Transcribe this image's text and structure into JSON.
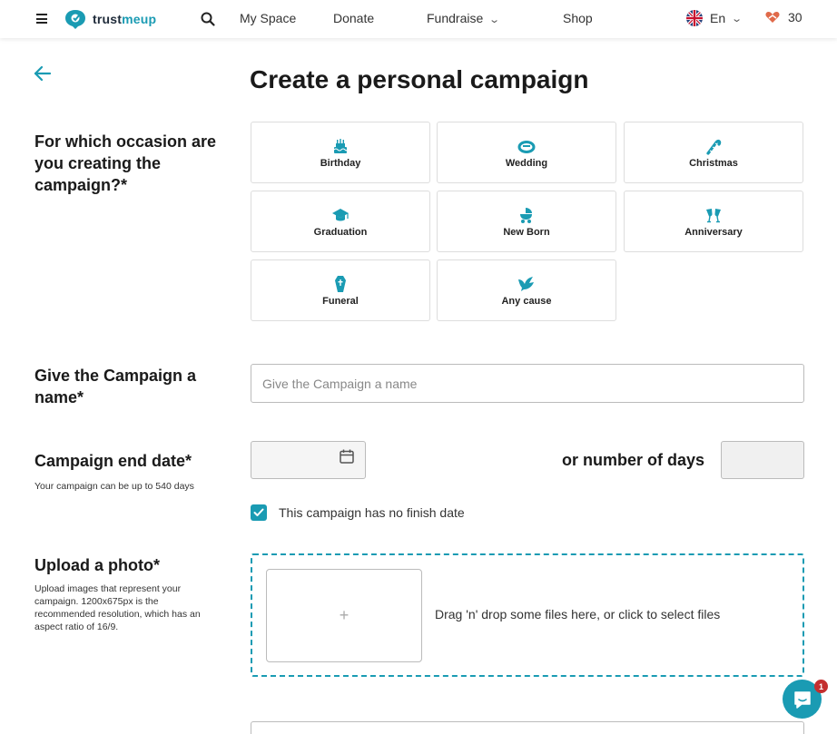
{
  "header": {
    "logo_prefix": "trust",
    "logo_suffix": "meup",
    "nav": [
      "My Space",
      "Donate",
      "Fundraise",
      "Shop"
    ],
    "language": "En",
    "points": "30"
  },
  "page": {
    "title": "Create a personal campaign"
  },
  "occasion": {
    "label": "For which occasion are you creating the campaign?*",
    "options": [
      {
        "label": "Birthday",
        "icon": "birthday-cake-icon"
      },
      {
        "label": "Wedding",
        "icon": "ring-icon"
      },
      {
        "label": "Christmas",
        "icon": "candy-cane-icon"
      },
      {
        "label": "Graduation",
        "icon": "graduation-cap-icon"
      },
      {
        "label": "New Born",
        "icon": "baby-carriage-icon"
      },
      {
        "label": "Anniversary",
        "icon": "champagne-glasses-icon"
      },
      {
        "label": "Funeral",
        "icon": "coffin-icon"
      },
      {
        "label": "Any cause",
        "icon": "bird-icon"
      }
    ]
  },
  "name_field": {
    "label": "Give the Campaign a name*",
    "placeholder": "Give the Campaign a name"
  },
  "end_date": {
    "label": "Campaign end date*",
    "hint": "Your campaign can be up to 540 days",
    "or_days_label": "or number of days",
    "no_finish_label": "This campaign has no finish date",
    "no_finish_checked": true
  },
  "photo": {
    "label": "Upload a photo*",
    "hint": "Upload images that represent your campaign. 1200x675px is the recommended resolution, which has an aspect ratio of 16/9.",
    "plus": "+",
    "dropzone_text": "Drag 'n' drop some files here, or click to select files"
  },
  "chat": {
    "badge": "1"
  },
  "colors": {
    "accent": "#1a9bb3",
    "badge": "#c42f2f"
  }
}
